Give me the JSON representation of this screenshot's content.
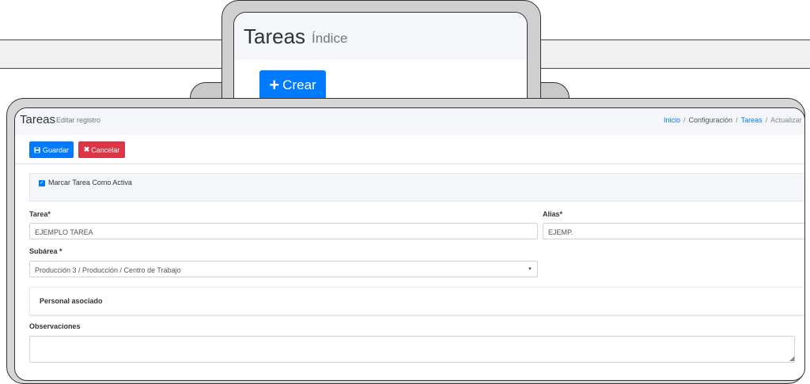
{
  "background_window": {
    "title": "Tareas",
    "subtitle": "Índice",
    "create_button": {
      "icon": "plus-icon",
      "label": "Crear"
    }
  },
  "header": {
    "title": "Tareas",
    "subtitle": "Editar registro",
    "breadcrumb": [
      "Inicio",
      "Configuración",
      "Tareas",
      "Actualizar"
    ]
  },
  "toolbar": {
    "save_label": "Guardar",
    "save_icon": "floppy-disk-icon",
    "cancel_label": "Cancelar",
    "cancel_icon": "x-icon"
  },
  "form": {
    "active_checkbox": {
      "label": "Marcar Tarea Como Activa",
      "checked": true
    },
    "tarea": {
      "label": "Tarea*",
      "value": "EJEMPLO TAREA"
    },
    "alias": {
      "label": "Alias*",
      "value": "EJEMP."
    },
    "subarea": {
      "label": "Subárea *",
      "value": "Producción 3 / Producción / Centro de Trabajo"
    },
    "personal_section_title": "Personal asociado",
    "observaciones": {
      "label": "Observaciones",
      "value": ""
    }
  },
  "colors": {
    "primary": "#007bff",
    "danger": "#dc3545",
    "header_bg": "#f4f6f9"
  }
}
